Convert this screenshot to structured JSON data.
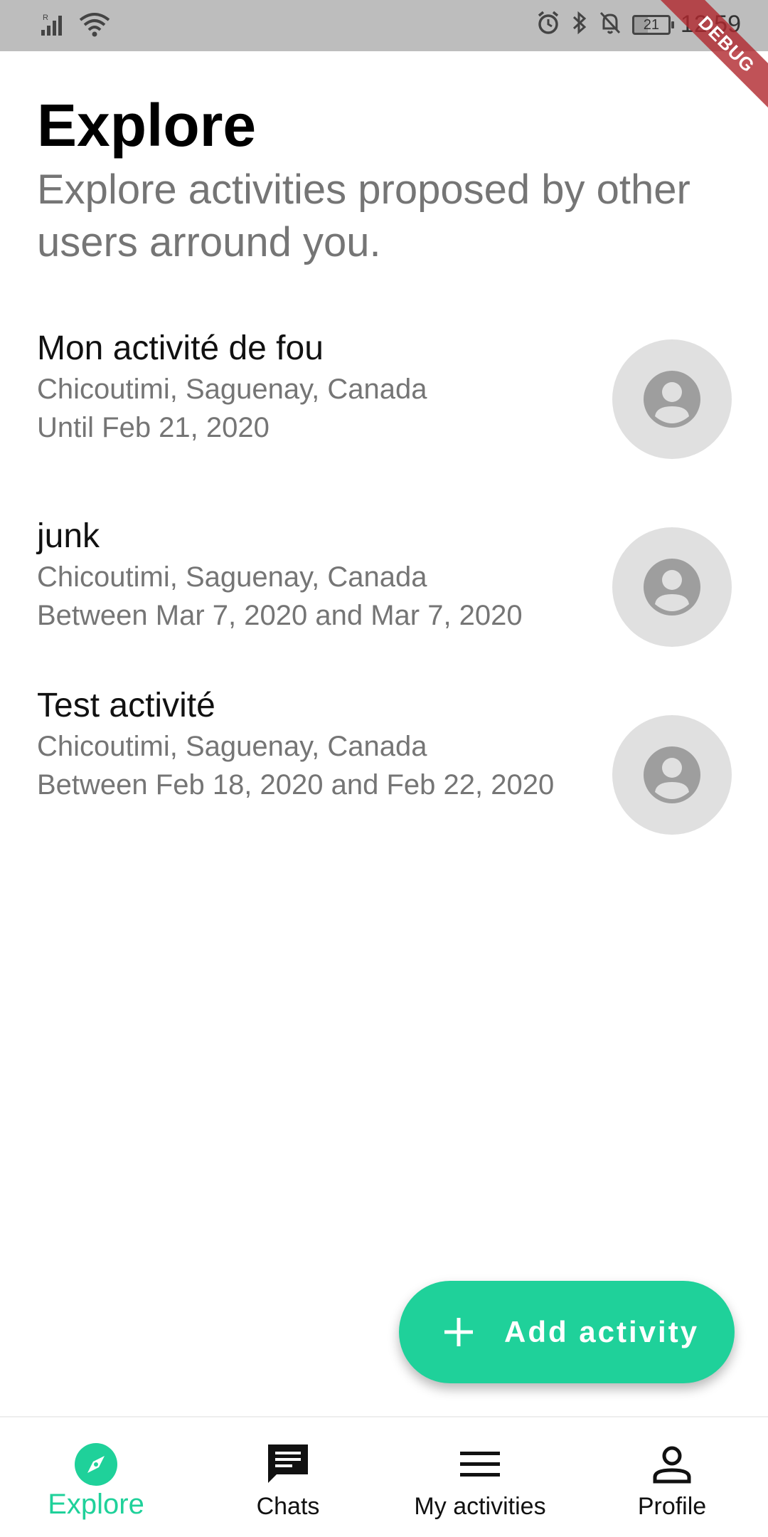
{
  "status_bar": {
    "time": "12:59",
    "battery": "21",
    "signal_icon": "signal-icon",
    "wifi_icon": "wifi-icon",
    "alarm_icon": "alarm-icon",
    "bluetooth_icon": "bluetooth-icon",
    "mute_icon": "notifications-off-icon"
  },
  "debug_banner": "DEBUG",
  "header": {
    "title": "Explore",
    "subtitle": "Explore activities proposed by other users arround you."
  },
  "activities": [
    {
      "title": "Mon activité de fou",
      "location": "Chicoutimi, Saguenay, Canada",
      "dates": "Until Feb 21, 2020"
    },
    {
      "title": "junk",
      "location": "Chicoutimi, Saguenay, Canada",
      "dates": "Between Mar 7, 2020 and Mar 7, 2020"
    },
    {
      "title": "Test activité",
      "location": "Chicoutimi, Saguenay, Canada",
      "dates": "Between Feb 18, 2020 and Feb 22, 2020"
    }
  ],
  "fab": {
    "label": "Add activity",
    "icon": "plus-icon"
  },
  "bottom_nav": {
    "items": [
      {
        "label": "Explore",
        "icon": "compass-icon",
        "active": true
      },
      {
        "label": "Chats",
        "icon": "chat-icon",
        "active": false
      },
      {
        "label": "My activities",
        "icon": "menu-icon",
        "active": false
      },
      {
        "label": "Profile",
        "icon": "person-icon",
        "active": false
      }
    ]
  },
  "colors": {
    "accent": "#1fd19a",
    "status_bar": "#bdbdbd",
    "secondary_text": "#757575",
    "avatar_bg": "#e0e0e0"
  }
}
